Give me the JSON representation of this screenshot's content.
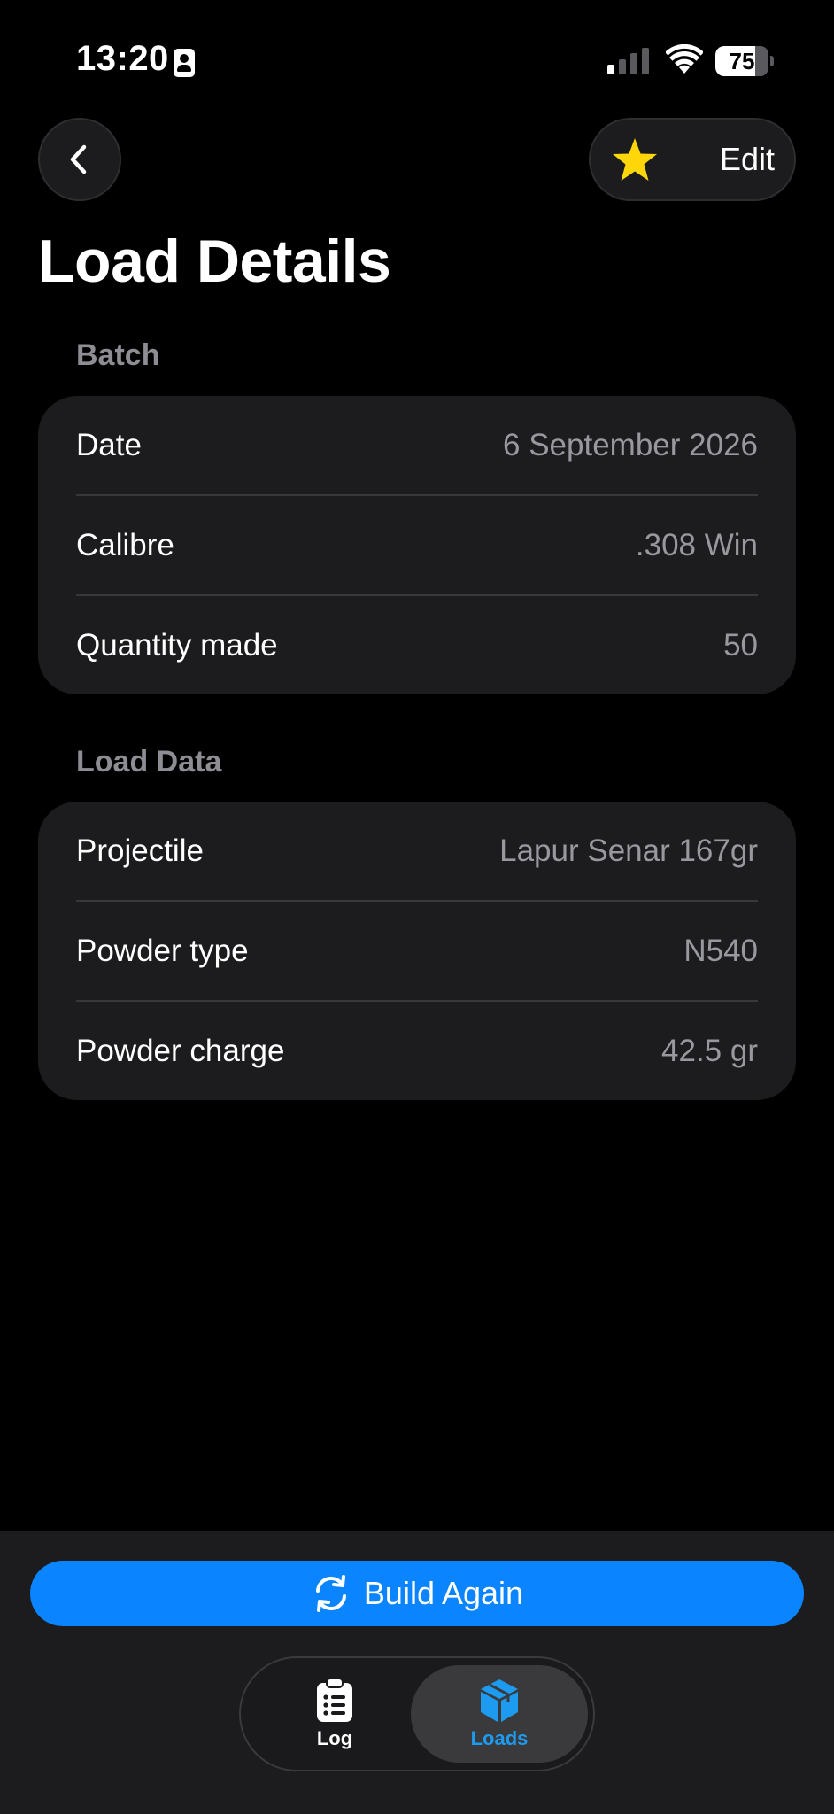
{
  "status_bar": {
    "time": "13:20",
    "battery_level": "75",
    "battery_fraction": 0.75,
    "signal_bars_active": 1,
    "signal_bars_total": 4
  },
  "nav": {
    "back_icon": "chevron-left-icon",
    "favorite_icon": "star-icon",
    "favorite_color": "#FFD60A",
    "edit_label": "Edit"
  },
  "page": {
    "title": "Load Details"
  },
  "batch": {
    "header": "Batch",
    "rows": [
      {
        "label": "Date",
        "value": "6 September 2026"
      },
      {
        "label": "Calibre",
        "value": ".308 Win"
      },
      {
        "label": "Quantity made",
        "value": "50"
      }
    ]
  },
  "load_data": {
    "header": "Load Data",
    "rows": [
      {
        "label": "Projectile",
        "value": "Lapur Senar 167gr"
      },
      {
        "label": "Powder type",
        "value": "N540"
      },
      {
        "label": "Powder charge",
        "value": "42.5 gr"
      }
    ]
  },
  "actions": {
    "build_again_label": "Build Again",
    "build_again_icon": "refresh-icon",
    "accent_color": "#0A84FF"
  },
  "tab_bar": {
    "tabs": [
      {
        "label": "Log",
        "icon": "clipboard-list-icon",
        "selected": false
      },
      {
        "label": "Loads",
        "icon": "cube-icon",
        "selected": true
      }
    ]
  }
}
